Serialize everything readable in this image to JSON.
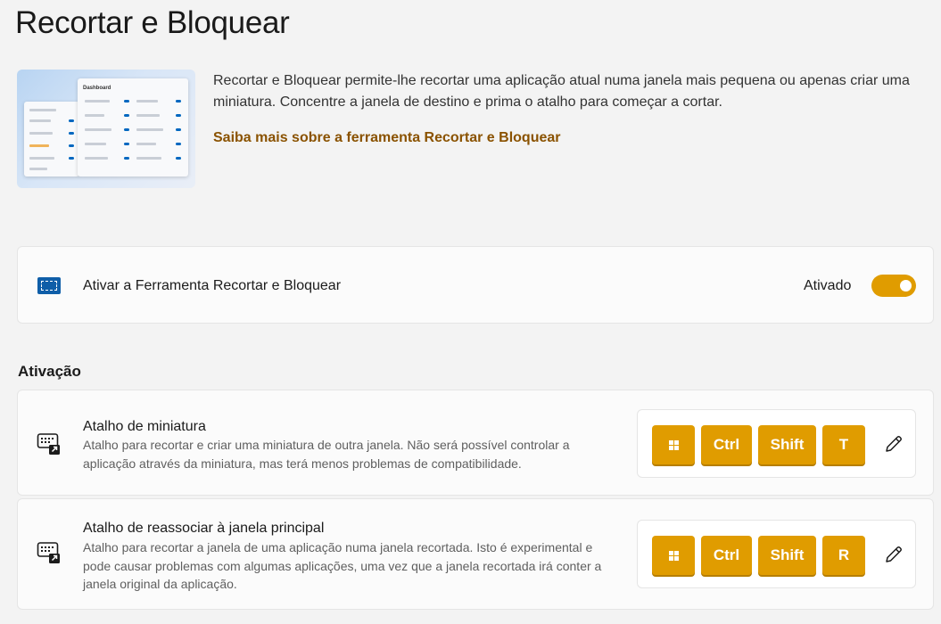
{
  "page": {
    "title": "Recortar e Bloquear"
  },
  "hero": {
    "description": "Recortar e Bloquear permite-lhe recortar uma aplicação atual numa janela mais pequena ou apenas criar uma miniatura. Concentre a janela de destino e prima o atalho para começar a cortar.",
    "link": "Saiba mais sobre a ferramenta Recortar e Bloquear",
    "image_label": "Dashboard"
  },
  "enable": {
    "label": "Ativar a Ferramenta Recortar e Bloquear",
    "state": "Ativado",
    "is_on": true,
    "icon": "crop-lock-icon"
  },
  "activation": {
    "header": "Ativação",
    "settings": [
      {
        "title": "Atalho de miniatura",
        "description": "Atalho para recortar e criar uma miniatura de outra janela. Não será possível controlar a aplicação através da miniatura, mas terá menos problemas de compatibilidade.",
        "keys": [
          "win",
          "Ctrl",
          "Shift",
          "T"
        ],
        "icon": "keyboard-shortcut-icon"
      },
      {
        "title": "Atalho de reassociar à janela principal",
        "description": "Atalho para recortar a janela de uma aplicação numa janela recortada. Isto é experimental e pode causar problemas com algumas aplicações, uma vez que a janela recortada irá conter a janela original da aplicação.",
        "keys": [
          "win",
          "Ctrl",
          "Shift",
          "R"
        ],
        "icon": "keyboard-shortcut-icon"
      }
    ]
  },
  "colors": {
    "accent": "#e09c00",
    "link": "#8a5200",
    "background": "#f3f3f3",
    "card": "#fbfbfb"
  }
}
